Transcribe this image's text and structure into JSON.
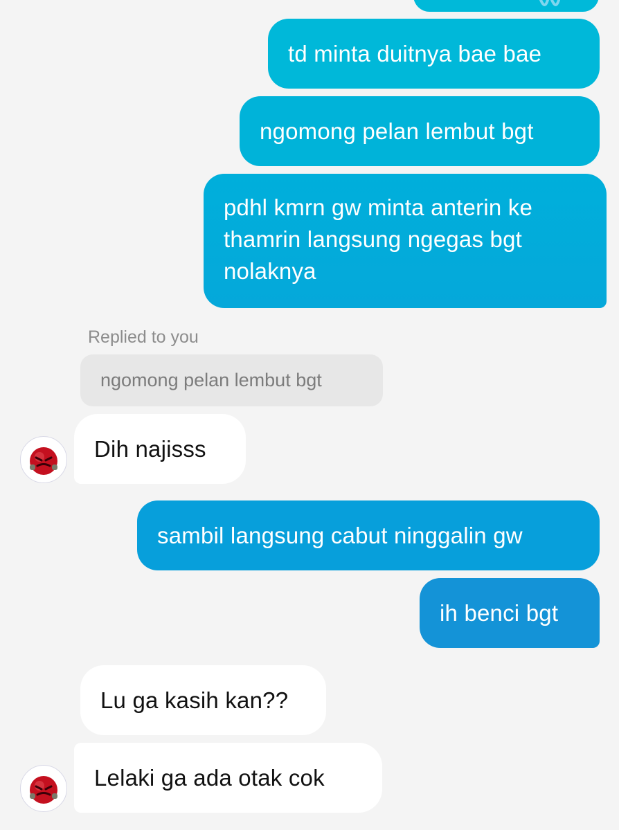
{
  "conversation": {
    "outgoing_top": [
      {
        "text": "td minta duitnya bae bae"
      },
      {
        "text": "ngomong pelan lembut bgt"
      },
      {
        "lines": [
          "pdhl kmrn gw minta anterin ke",
          "thamrin langsung ngegas bgt",
          "nolaknya"
        ]
      }
    ],
    "reply": {
      "label": "Replied to you",
      "quoted_text": "ngomong pelan lembut bgt"
    },
    "incoming_first": {
      "text": "Dih najisss"
    },
    "outgoing_bottom": [
      {
        "text": "sambil langsung cabut ninggalin gw"
      },
      {
        "text": "ih benci bgt"
      }
    ],
    "incoming_last": [
      {
        "text": "Lu ga kasih kan??"
      },
      {
        "text": "Lelaki ga ada otak cok"
      }
    ]
  },
  "colors": {
    "outgoing_gradient": [
      "#00b7d8",
      "#1392d6"
    ],
    "incoming_bubble": "#ffffff",
    "background": "#f4f4f4",
    "quoted_bubble": "#e7e7e7"
  },
  "icons": {
    "avatar": "red-angry-emoji-avatar"
  }
}
